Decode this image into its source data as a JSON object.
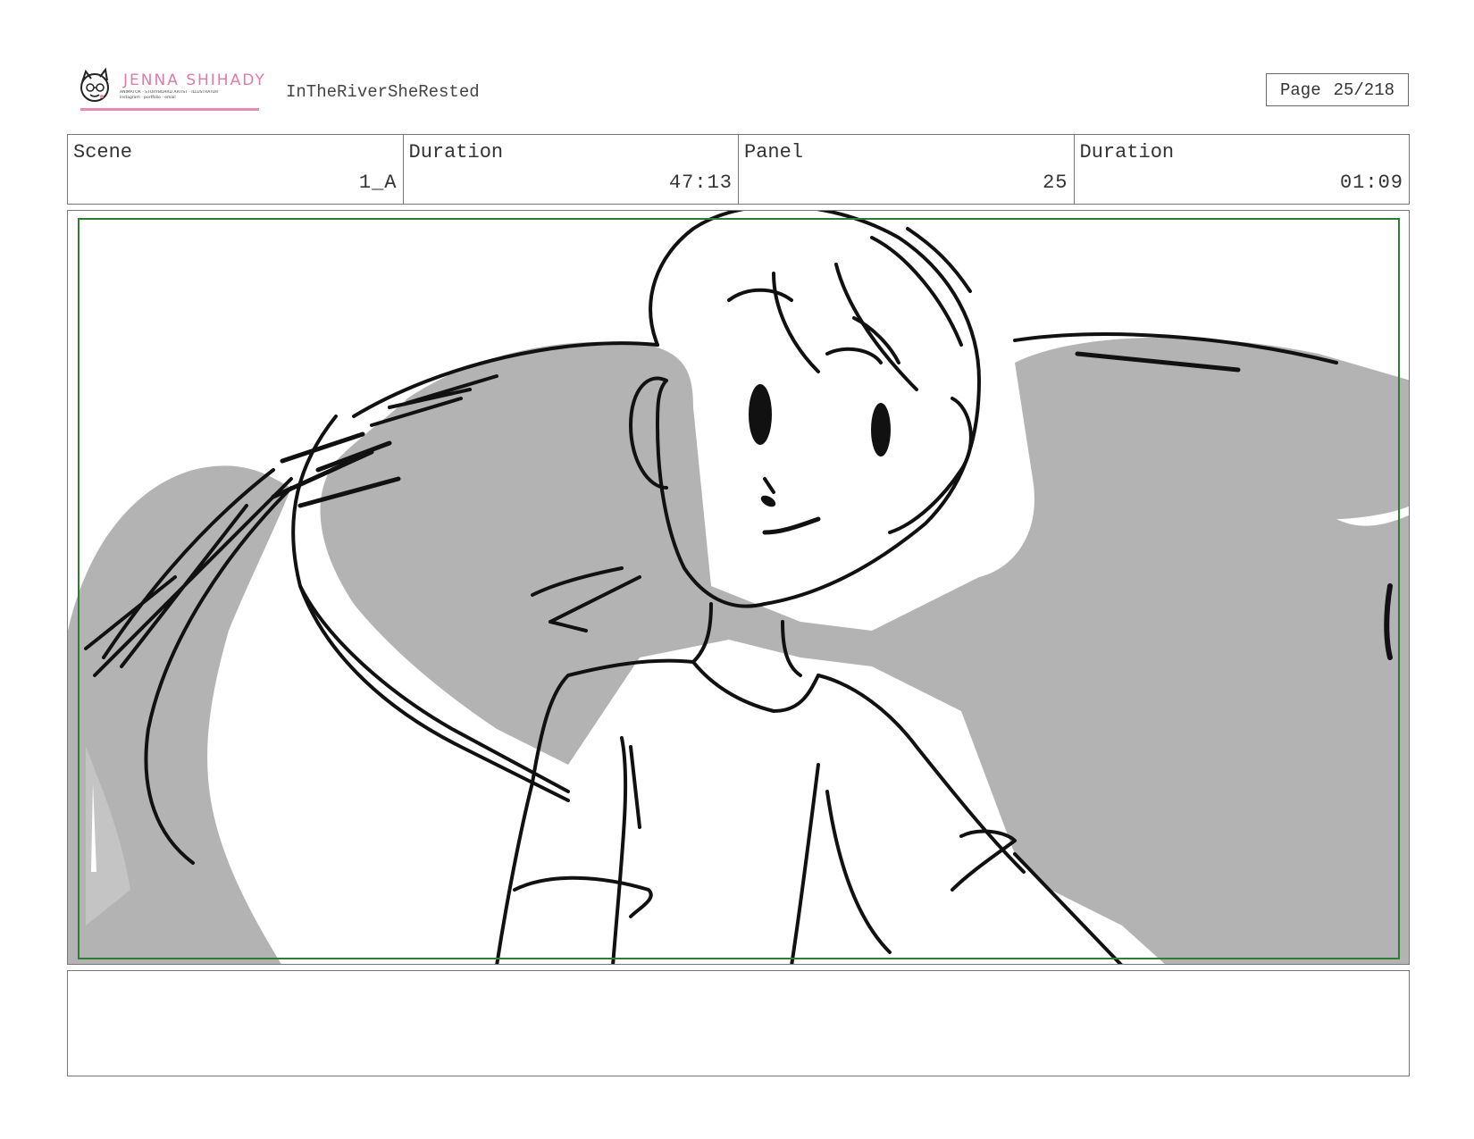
{
  "header": {
    "logo": {
      "name": "JENNA SHIHADY",
      "tagline": "ANIMATOR · STORYBOARD ARTIST · ILLUSTRATOR",
      "contact": "instagram · portfolio · email"
    },
    "project_title": "InTheRiverSheRested",
    "page_label": "Page",
    "page_value": "25/218"
  },
  "info": {
    "scene_label": "Scene",
    "scene_value": "1_A",
    "scene_duration_label": "Duration",
    "scene_duration_value": "47:13",
    "panel_label": "Panel",
    "panel_value": "25",
    "panel_duration_label": "Duration",
    "panel_duration_value": "01:09"
  },
  "notes": {
    "text": ""
  },
  "colors": {
    "safe_frame": "#2e7d32",
    "shadow_fill": "#b3b3b3",
    "ink": "#111111",
    "brand_pink": "#e07aa8"
  }
}
